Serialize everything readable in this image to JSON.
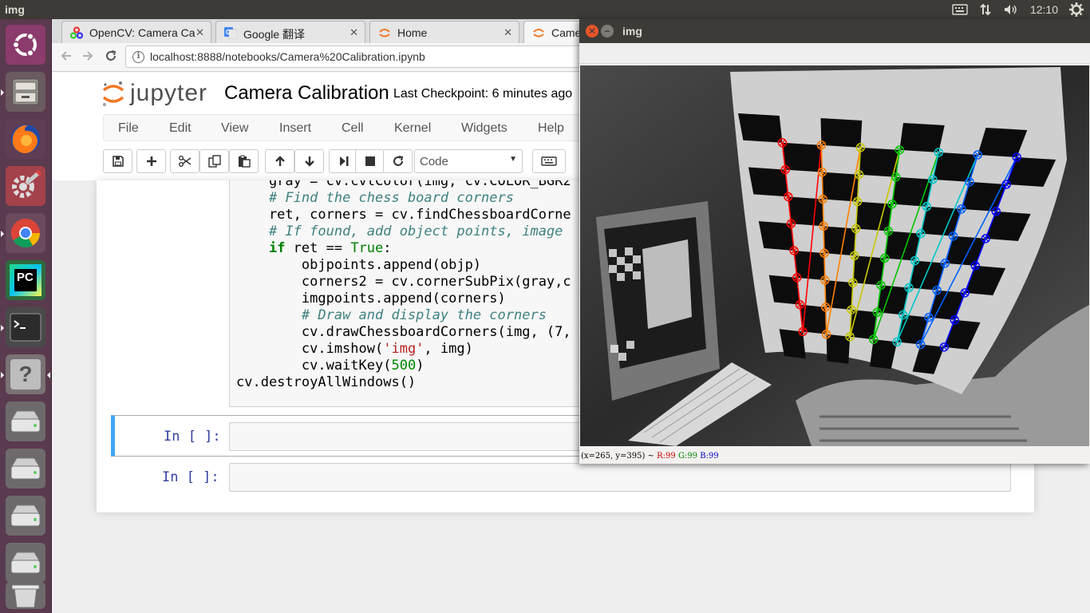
{
  "topbar": {
    "app_name": "img",
    "clock": "12:10"
  },
  "launcher": {
    "items": [
      {
        "name": "ubuntu-dash",
        "icon": "ubuntu-logo-icon"
      },
      {
        "name": "files",
        "icon": "file-cabinet-icon"
      },
      {
        "name": "firefox",
        "icon": "firefox-icon"
      },
      {
        "name": "system-settings",
        "icon": "settings-icon"
      },
      {
        "name": "chrome",
        "icon": "chrome-icon"
      },
      {
        "name": "pycharm",
        "icon": "pycharm-icon"
      },
      {
        "name": "terminal",
        "icon": "terminal-icon"
      },
      {
        "name": "help",
        "icon": "help-icon"
      },
      {
        "name": "drive-1",
        "icon": "drive-icon"
      },
      {
        "name": "drive-2",
        "icon": "drive-icon"
      },
      {
        "name": "drive-3",
        "icon": "drive-icon"
      },
      {
        "name": "drive-4",
        "icon": "drive-icon"
      },
      {
        "name": "trash",
        "icon": "trash-icon"
      }
    ],
    "pycharm_text": "PC",
    "help_text": "?"
  },
  "browser": {
    "tabs": [
      {
        "label": "OpenCV: Camera Ca",
        "icon": "opencv-icon",
        "close": "✕"
      },
      {
        "label": "Google 翻译",
        "icon": "google-translate-icon",
        "close": "✕"
      },
      {
        "label": "Home",
        "icon": "jupyter-icon",
        "close": "✕"
      },
      {
        "label": "Came",
        "icon": "jupyter-icon"
      }
    ],
    "url": "localhost:8888/notebooks/Camera%20Calibration.ipynb"
  },
  "notebook": {
    "logo_text": "jupyter",
    "title": "Camera Calibration",
    "checkpoint": "Last Checkpoint: 6 minutes ago",
    "menu": [
      "File",
      "Edit",
      "View",
      "Insert",
      "Cell",
      "Kernel",
      "Widgets",
      "Help"
    ],
    "cell_type": "Code",
    "code_lines": {
      "l1": "    gray = cv.cvtColor(img, cv.COLOR_BGR2",
      "l2": "# Find the chess board corners",
      "l3": "    ret, corners = cv.findChessboardCorne",
      "l4": "# If found, add object points, image",
      "l5_kw": "if",
      "l5_mid": " ret == ",
      "l5_true": "True",
      "l5_end": ":",
      "l6": "        objpoints.append(objp)",
      "l7": "        corners2 = cv.cornerSubPix(gray,c",
      "l8": "        imgpoints.append(corners)",
      "l9": "# Draw and display the corners",
      "l10": "        cv.drawChessboardCorners(img, (7,",
      "l11_a": "        cv.imshow(",
      "l11_str": "'img'",
      "l11_b": ", img)",
      "l12_a": "        cv.waitKey(",
      "l12_num": "500",
      "l12_b": ")",
      "l13": "cv.destroyAllWindows()"
    },
    "empty_cells": [
      {
        "prompt": "In [ ]:"
      },
      {
        "prompt": "In [ ]:"
      }
    ]
  },
  "image_window": {
    "title": "img",
    "close_glyph": "✕",
    "min_glyph": "−",
    "status_prefix": "(x=265, y=395) ~ ",
    "status_r": "R:99",
    "status_g": "G:99",
    "status_b": "B:99",
    "colors": {
      "corner_cols": [
        "#ff0000",
        "#ff8000",
        "#c8c800",
        "#00c800",
        "#00c8c8",
        "#0060ff",
        "#0000ff"
      ]
    }
  }
}
